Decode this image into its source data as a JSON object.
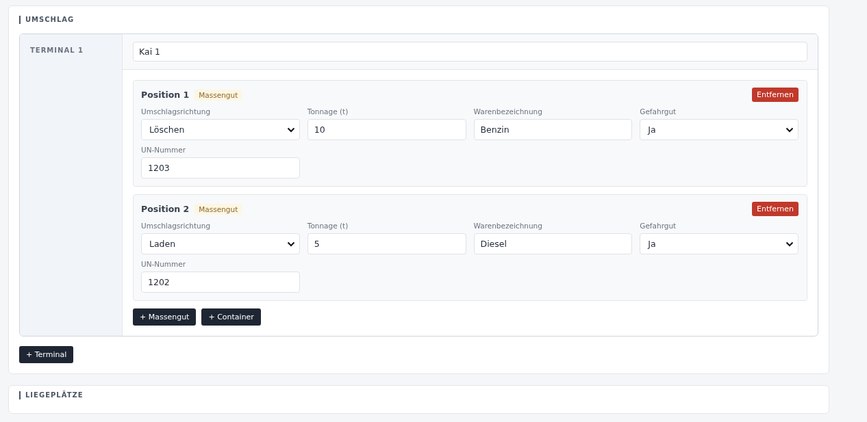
{
  "sections": [
    {
      "title": "UMSCHLAG",
      "terminals": [
        {
          "label": "TERMINAL 1",
          "name_value": "Kai 1",
          "positions": [
            {
              "title": "Position 1",
              "badge": "Massengut",
              "remove_button": "Entfernen",
              "fields": [
                {
                  "kind": "select",
                  "label": "Umschlagsrichtung",
                  "value": "Löschen"
                },
                {
                  "kind": "input",
                  "label": "Tonnage (t)",
                  "value": "10"
                },
                {
                  "kind": "input",
                  "label": "Warenbezeichnung",
                  "value": "Benzin"
                },
                {
                  "kind": "select",
                  "label": "Gefahrgut",
                  "value": "Ja"
                },
                {
                  "kind": "input",
                  "label": "UN-Nummer",
                  "value": "1203"
                }
              ]
            },
            {
              "title": "Position 2",
              "badge": "Massengut",
              "remove_button": "Entfernen",
              "fields": [
                {
                  "kind": "select",
                  "label": "Umschlagsrichtung",
                  "value": "Laden"
                },
                {
                  "kind": "input",
                  "label": "Tonnage (t)",
                  "value": "5"
                },
                {
                  "kind": "input",
                  "label": "Warenbezeichnung",
                  "value": "Diesel"
                },
                {
                  "kind": "select",
                  "label": "Gefahrgut",
                  "value": "Ja"
                },
                {
                  "kind": "input",
                  "label": "UN-Nummer",
                  "value": "1202"
                }
              ]
            }
          ],
          "add_buttons": [
            "+ Massengut",
            "+ Container"
          ]
        }
      ],
      "add_button": "+ Terminal"
    },
    {
      "title": "LIEGEPLÄTZE"
    }
  ]
}
